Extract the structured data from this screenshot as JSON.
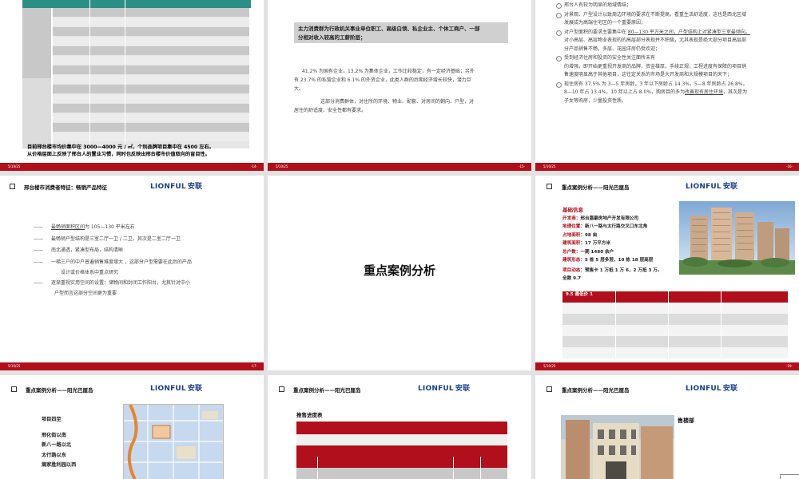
{
  "footer": {
    "date": "5/10/25",
    "pages": [
      "-14-",
      "-15-",
      "-16-",
      "-17-",
      "-18-",
      "-19-"
    ]
  },
  "brand": {
    "logo_en": "LIONFUL",
    "logo_cn": "安联"
  },
  "colors": {
    "accent": "#b20f1c",
    "teal": "#2c8f86",
    "logo": "#1b3d8c"
  },
  "slide1": {
    "note_line1": "目前邢台楼市均价集中在 3000—4000 元 / ㎡，个别品牌项目集中在 4500 左右。",
    "note_line2": "从价格层面上反映了邢台人的置业习惯，同时也反映出邢台楼市价值取向的盲目性。"
  },
  "slide2": {
    "highlight_line1": "主力消费群为行政机关事业单位职工、高级白领、私企业主、个体工商户、一部",
    "highlight_line2": "分相对收入较高的工薪阶层；",
    "para1_line1": "41.2% 为国有企业，13.2% 为集体企业，工作比较稳定，有一定经济基础；另外",
    "para1_line2": "有 23.7% 的私营企业和 6.1% 的外资企业，此类人群的后期经济增长较快，潜力巨",
    "para1_line3": "大。",
    "para2_line1": "这部分消费群体，对住所的环境、物业、配套、对房间的朝向、户型，对",
    "para2_line2": "居住的舒适度、安全性都有要求。"
  },
  "slide3": {
    "items": [
      {
        "line1": "邢台人有较为明显的地域情结；",
        "line2": ""
      },
      {
        "line1": "对景观、户型设计以致周边环境的要求在不断提高，看重生活舒适度，这也是西北区域",
        "line2": "发展成为高端住宅区的一个重要原因；"
      },
      {
        "line1_pre": "对户型面积的要求主要集中在 ",
        "line1_ul": "80—130 平方米之间，户型结构上对紧凑型三室最倾向。",
        "line2": "对小高层、高层物业表现的的高层部分表现并不积极，尤其表现是绝大部分项目高层部",
        "line3": "分产品销售不畅，多层、花园洋房仍受欢迎；"
      },
      {
        "line1": "受到经济住房和投资的安全性关注面所未有",
        "line1b": "的增强，即开始更重视开发商的品牌，资金雄厚、手续正规，工程进度有保障的项目销",
        "line2": "售速度明显高于其他项目，这往定关系的市场是大开发商和大规模项目的天下；"
      },
      {
        "line1": "现住房有 37.5% 为 3—5 年房龄，3 年以下房龄占 14.3%，5—8 年房龄占 26.8%，",
        "line2_pre": "8—10 年占 13.4%，10 年以上占 8.0%，购房目的多为",
        "line2_ul": "改善现有居住环境",
        "line2_post": "，其次是为",
        "line3": "子女等购房，少量投资性质。"
      }
    ]
  },
  "slide4": {
    "title": "邢台楼市消费者特征：畅销产品特征",
    "lines": [
      {
        "dash": "——",
        "text_ul": "最畅销面积区间",
        "text": "为 105—130 平米左右"
      },
      {
        "dash": "——",
        "text": "最畅销户型结构是三室二厅一卫 / 二卫，其次是二室二厅一卫"
      },
      {
        "dash": "——",
        "text": "南北通透，紧凑型布局，结构清晰"
      },
      {
        "dash": "——",
        "text": "一梯三户的中户普遍销售难度增大 ，这部分户型需要在此后的产品"
      },
      {
        "dash": "",
        "text": "设计或价格体系中重点研究"
      },
      {
        "dash": "——",
        "text": "逐渐重视实用空间的设置：储物间和封闭工作阳台，尤其针对中小"
      },
      {
        "dash": "",
        "text": "户型而言这部分空间更为重要"
      }
    ]
  },
  "slide5": {
    "title": "重点案例分析"
  },
  "slide6": {
    "title": "重点案例分析——阳光巴厘岛",
    "info_header": "基础信息",
    "developer_label": "开发商：",
    "developer": "邢台嘉豪房地产开发有限公司",
    "location_label": "地理位置：",
    "location": "新八一路与太行路交叉口东北角",
    "area_label": "占地面积：",
    "area": "98 亩",
    "build_label": "建筑面积：",
    "build": "17 万平方米",
    "households_label": "总户数：",
    "households": "一期 1480 余户",
    "form_label": "建筑形态：",
    "form": "5 栋 5 层多层，10 栋 18 层高层",
    "move_label": "项目动态：",
    "move": "预售卡 1 万抵 1 万 6，2 万抵 3 万。",
    "move2": "全款 9.7",
    "table_overlap": "9.5 最低价 1"
  },
  "slide7": {
    "title": "重点案例分析——阳光巴厘岛",
    "heading": "项目四至",
    "bounds": [
      "邢化街以南",
      "新八一路以北",
      "太行路以东",
      "嵩家胜利园以西"
    ]
  },
  "slide8": {
    "title": "重点案例分析——阳光巴厘岛",
    "sub": "推售进度表"
  },
  "slide9": {
    "title": "重点案例分析——阳光巴厘岛",
    "label": "售楼部"
  }
}
